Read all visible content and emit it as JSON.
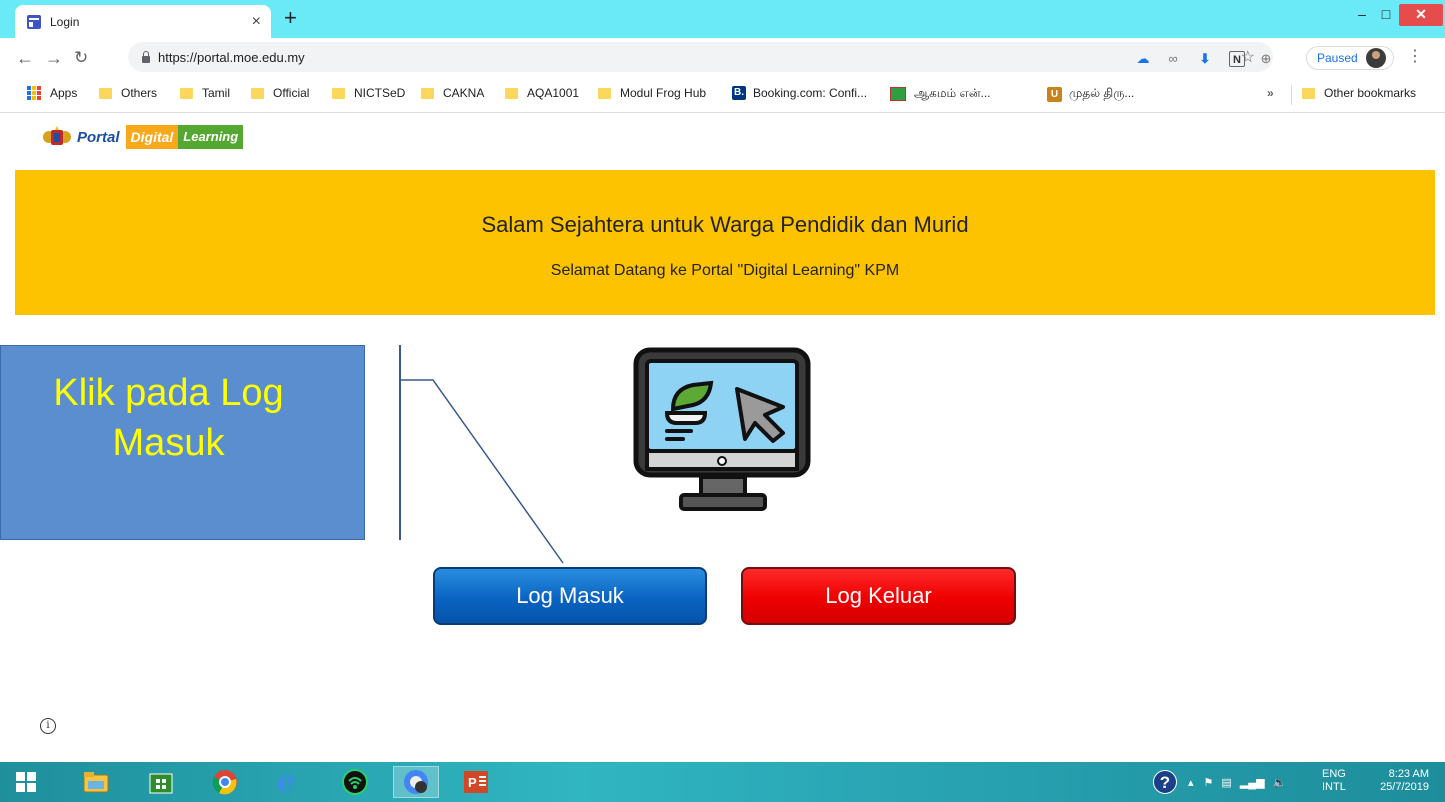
{
  "browser": {
    "tab_title": "Login",
    "tab_close": "×",
    "new_tab": "+",
    "url": "https://portal.moe.edu.my",
    "paused_label": "Paused",
    "window_controls": {
      "minimize": "–",
      "maximize": "□",
      "close": "✕"
    }
  },
  "bookmarks": {
    "apps": "Apps",
    "items": [
      "Others",
      "Tamil",
      "Official",
      "NICTSeD",
      "CAKNA",
      "AQA1001",
      "Modul Frog Hub"
    ],
    "booking": "Booking.com: Confi...",
    "tamil1": "ஆகமம் என்...",
    "tamil2": "முதல் திரு...",
    "more": "»",
    "other": "Other bookmarks"
  },
  "page": {
    "logo_portal": "Portal",
    "logo_digital": "Digital",
    "logo_learning": "Learning",
    "banner_title": "Salam Sejahtera untuk Warga Pendidik dan Murid",
    "banner_subtitle": "Selamat Datang ke Portal \"Digital Learning\" KPM",
    "login_button": "Log Masuk",
    "logout_button": "Log Keluar",
    "info_icon": "i"
  },
  "callout": {
    "line1": "Klik pada Log",
    "line2": "Masuk"
  },
  "taskbar": {
    "help": "?",
    "lang1": "ENG",
    "lang2": "INTL",
    "time": "8:23 AM",
    "date": "25/7/2019"
  },
  "colors": {
    "tab_strip": "#6ae9f6",
    "banner": "#fec300",
    "login_button": "#0a64c2",
    "logout_button": "#ee0000",
    "callout_box": "#5b8ecf",
    "callout_text": "#ffff00",
    "taskbar": "#2aa6b5"
  }
}
